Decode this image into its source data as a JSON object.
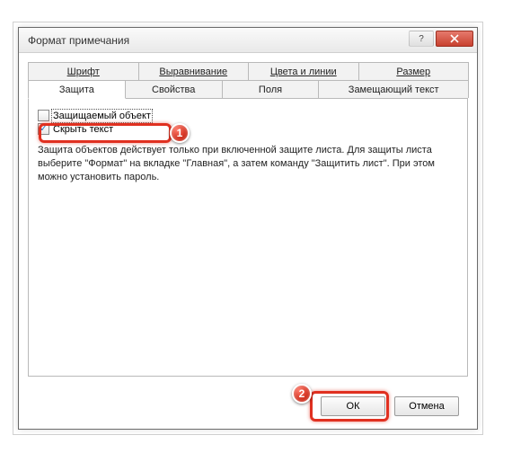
{
  "dialog": {
    "title": "Формат примечания"
  },
  "tabs": {
    "row1": [
      {
        "label": "Шрифт"
      },
      {
        "label": "Выравнивание"
      },
      {
        "label": "Цвета и линии"
      },
      {
        "label": "Размер"
      }
    ],
    "row2": [
      {
        "label": "Защита",
        "active": true
      },
      {
        "label": "Свойства"
      },
      {
        "label": "Поля"
      },
      {
        "label": "Замещающий текст"
      }
    ]
  },
  "protection": {
    "lock_object_label": "Защищаемый объект",
    "lock_object_checked": false,
    "hide_text_label": "Скрыть текст",
    "hide_text_checked": true,
    "description": "Защита объектов действует только при включенной защите листа. Для защиты листа выберите \"Формат\" на вкладке \"Главная\", а затем команду \"Защитить лист\". При этом можно установить пароль."
  },
  "buttons": {
    "ok": "ОК",
    "cancel": "Отмена"
  },
  "callouts": {
    "c1": "1",
    "c2": "2"
  }
}
